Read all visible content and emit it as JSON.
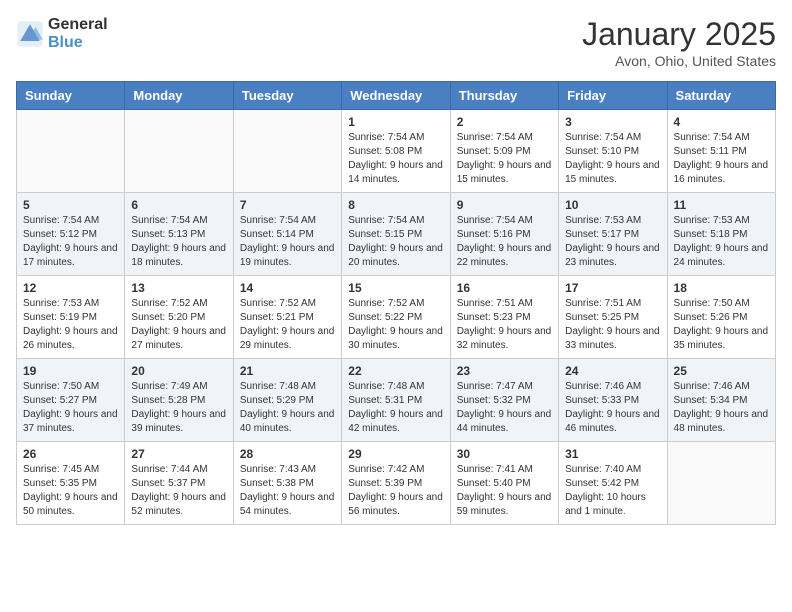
{
  "logo": {
    "general": "General",
    "blue": "Blue"
  },
  "title": "January 2025",
  "location": "Avon, Ohio, United States",
  "days_of_week": [
    "Sunday",
    "Monday",
    "Tuesday",
    "Wednesday",
    "Thursday",
    "Friday",
    "Saturday"
  ],
  "weeks": [
    [
      {
        "day": "",
        "info": ""
      },
      {
        "day": "",
        "info": ""
      },
      {
        "day": "",
        "info": ""
      },
      {
        "day": "1",
        "sunrise": "Sunrise: 7:54 AM",
        "sunset": "Sunset: 5:08 PM",
        "daylight": "Daylight: 9 hours and 14 minutes."
      },
      {
        "day": "2",
        "sunrise": "Sunrise: 7:54 AM",
        "sunset": "Sunset: 5:09 PM",
        "daylight": "Daylight: 9 hours and 15 minutes."
      },
      {
        "day": "3",
        "sunrise": "Sunrise: 7:54 AM",
        "sunset": "Sunset: 5:10 PM",
        "daylight": "Daylight: 9 hours and 15 minutes."
      },
      {
        "day": "4",
        "sunrise": "Sunrise: 7:54 AM",
        "sunset": "Sunset: 5:11 PM",
        "daylight": "Daylight: 9 hours and 16 minutes."
      }
    ],
    [
      {
        "day": "5",
        "sunrise": "Sunrise: 7:54 AM",
        "sunset": "Sunset: 5:12 PM",
        "daylight": "Daylight: 9 hours and 17 minutes."
      },
      {
        "day": "6",
        "sunrise": "Sunrise: 7:54 AM",
        "sunset": "Sunset: 5:13 PM",
        "daylight": "Daylight: 9 hours and 18 minutes."
      },
      {
        "day": "7",
        "sunrise": "Sunrise: 7:54 AM",
        "sunset": "Sunset: 5:14 PM",
        "daylight": "Daylight: 9 hours and 19 minutes."
      },
      {
        "day": "8",
        "sunrise": "Sunrise: 7:54 AM",
        "sunset": "Sunset: 5:15 PM",
        "daylight": "Daylight: 9 hours and 20 minutes."
      },
      {
        "day": "9",
        "sunrise": "Sunrise: 7:54 AM",
        "sunset": "Sunset: 5:16 PM",
        "daylight": "Daylight: 9 hours and 22 minutes."
      },
      {
        "day": "10",
        "sunrise": "Sunrise: 7:53 AM",
        "sunset": "Sunset: 5:17 PM",
        "daylight": "Daylight: 9 hours and 23 minutes."
      },
      {
        "day": "11",
        "sunrise": "Sunrise: 7:53 AM",
        "sunset": "Sunset: 5:18 PM",
        "daylight": "Daylight: 9 hours and 24 minutes."
      }
    ],
    [
      {
        "day": "12",
        "sunrise": "Sunrise: 7:53 AM",
        "sunset": "Sunset: 5:19 PM",
        "daylight": "Daylight: 9 hours and 26 minutes."
      },
      {
        "day": "13",
        "sunrise": "Sunrise: 7:52 AM",
        "sunset": "Sunset: 5:20 PM",
        "daylight": "Daylight: 9 hours and 27 minutes."
      },
      {
        "day": "14",
        "sunrise": "Sunrise: 7:52 AM",
        "sunset": "Sunset: 5:21 PM",
        "daylight": "Daylight: 9 hours and 29 minutes."
      },
      {
        "day": "15",
        "sunrise": "Sunrise: 7:52 AM",
        "sunset": "Sunset: 5:22 PM",
        "daylight": "Daylight: 9 hours and 30 minutes."
      },
      {
        "day": "16",
        "sunrise": "Sunrise: 7:51 AM",
        "sunset": "Sunset: 5:23 PM",
        "daylight": "Daylight: 9 hours and 32 minutes."
      },
      {
        "day": "17",
        "sunrise": "Sunrise: 7:51 AM",
        "sunset": "Sunset: 5:25 PM",
        "daylight": "Daylight: 9 hours and 33 minutes."
      },
      {
        "day": "18",
        "sunrise": "Sunrise: 7:50 AM",
        "sunset": "Sunset: 5:26 PM",
        "daylight": "Daylight: 9 hours and 35 minutes."
      }
    ],
    [
      {
        "day": "19",
        "sunrise": "Sunrise: 7:50 AM",
        "sunset": "Sunset: 5:27 PM",
        "daylight": "Daylight: 9 hours and 37 minutes."
      },
      {
        "day": "20",
        "sunrise": "Sunrise: 7:49 AM",
        "sunset": "Sunset: 5:28 PM",
        "daylight": "Daylight: 9 hours and 39 minutes."
      },
      {
        "day": "21",
        "sunrise": "Sunrise: 7:48 AM",
        "sunset": "Sunset: 5:29 PM",
        "daylight": "Daylight: 9 hours and 40 minutes."
      },
      {
        "day": "22",
        "sunrise": "Sunrise: 7:48 AM",
        "sunset": "Sunset: 5:31 PM",
        "daylight": "Daylight: 9 hours and 42 minutes."
      },
      {
        "day": "23",
        "sunrise": "Sunrise: 7:47 AM",
        "sunset": "Sunset: 5:32 PM",
        "daylight": "Daylight: 9 hours and 44 minutes."
      },
      {
        "day": "24",
        "sunrise": "Sunrise: 7:46 AM",
        "sunset": "Sunset: 5:33 PM",
        "daylight": "Daylight: 9 hours and 46 minutes."
      },
      {
        "day": "25",
        "sunrise": "Sunrise: 7:46 AM",
        "sunset": "Sunset: 5:34 PM",
        "daylight": "Daylight: 9 hours and 48 minutes."
      }
    ],
    [
      {
        "day": "26",
        "sunrise": "Sunrise: 7:45 AM",
        "sunset": "Sunset: 5:35 PM",
        "daylight": "Daylight: 9 hours and 50 minutes."
      },
      {
        "day": "27",
        "sunrise": "Sunrise: 7:44 AM",
        "sunset": "Sunset: 5:37 PM",
        "daylight": "Daylight: 9 hours and 52 minutes."
      },
      {
        "day": "28",
        "sunrise": "Sunrise: 7:43 AM",
        "sunset": "Sunset: 5:38 PM",
        "daylight": "Daylight: 9 hours and 54 minutes."
      },
      {
        "day": "29",
        "sunrise": "Sunrise: 7:42 AM",
        "sunset": "Sunset: 5:39 PM",
        "daylight": "Daylight: 9 hours and 56 minutes."
      },
      {
        "day": "30",
        "sunrise": "Sunrise: 7:41 AM",
        "sunset": "Sunset: 5:40 PM",
        "daylight": "Daylight: 9 hours and 59 minutes."
      },
      {
        "day": "31",
        "sunrise": "Sunrise: 7:40 AM",
        "sunset": "Sunset: 5:42 PM",
        "daylight": "Daylight: 10 hours and 1 minute."
      },
      {
        "day": "",
        "info": ""
      }
    ]
  ]
}
